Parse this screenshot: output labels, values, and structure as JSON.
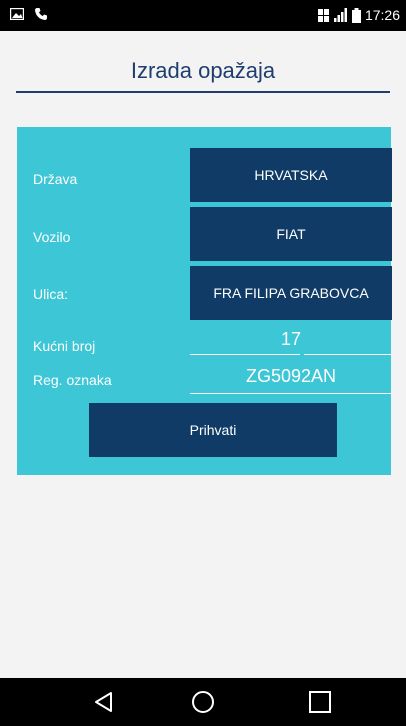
{
  "status_bar": {
    "time": "17:26",
    "icons": [
      "gallery-icon",
      "phone-icon",
      "sim-icon",
      "signal-icon",
      "battery-icon"
    ]
  },
  "header": {
    "title": "Izrada opažaja"
  },
  "form": {
    "country_label": "Država",
    "country_value": "HRVATSKA",
    "vehicle_label": "Vozilo",
    "vehicle_value": "FIAT",
    "street_label": "Ulica:",
    "street_value": "FRA FILIPA GRABOVCA",
    "house_number_label": "Kućni broj",
    "house_number_value": "17",
    "plate_label": "Reg. oznaka",
    "plate_value": "ZG5092AN",
    "accept_label": "Prihvati"
  },
  "nav_bar": {
    "icons": [
      "back-icon",
      "home-icon",
      "recent-apps-icon"
    ]
  },
  "colors": {
    "panel": "#3dc6d6",
    "button": "#0f3b66",
    "title": "#1f3e6e"
  }
}
